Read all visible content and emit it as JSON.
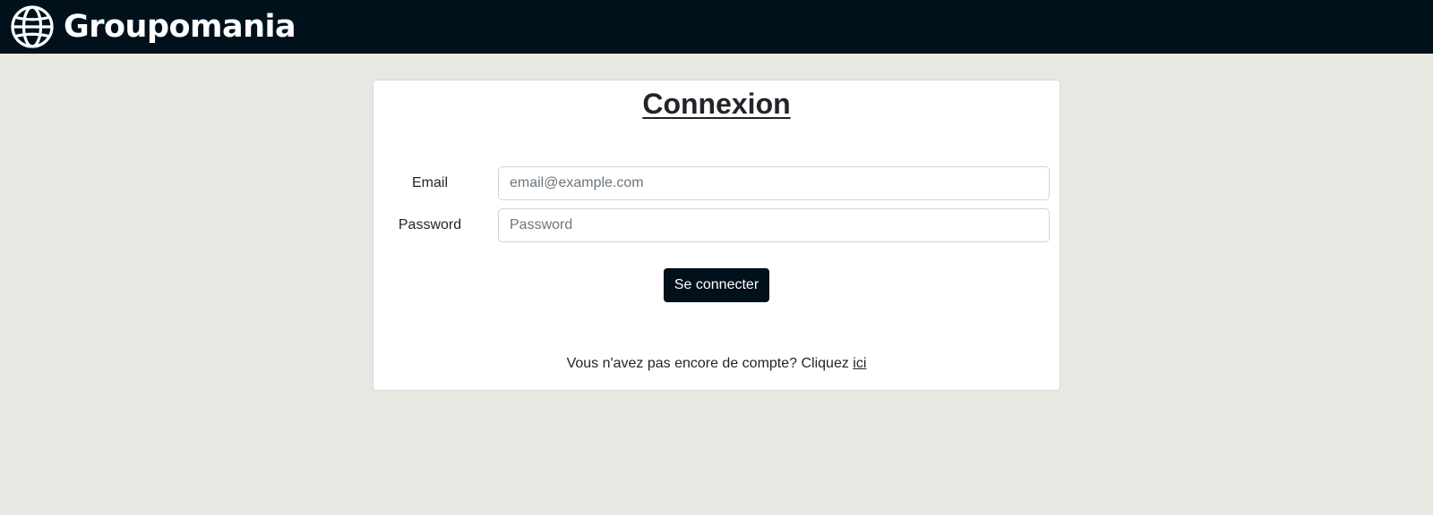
{
  "header": {
    "brand_name": "Groupomania",
    "brand_icon": "globe-icon",
    "background_color": "#00111c"
  },
  "login": {
    "title": "Connexion",
    "email": {
      "label": "Email",
      "placeholder": "email@example.com",
      "value": ""
    },
    "password": {
      "label": "Password",
      "placeholder": "Password",
      "value": ""
    },
    "submit_label": "Se connecter",
    "signup_prompt": "Vous n'avez pas encore de compte? Cliquez ",
    "signup_link": "ici"
  },
  "colors": {
    "page_background": "#e8e8e3",
    "button_background": "#00111c",
    "button_text": "#ffffff"
  }
}
